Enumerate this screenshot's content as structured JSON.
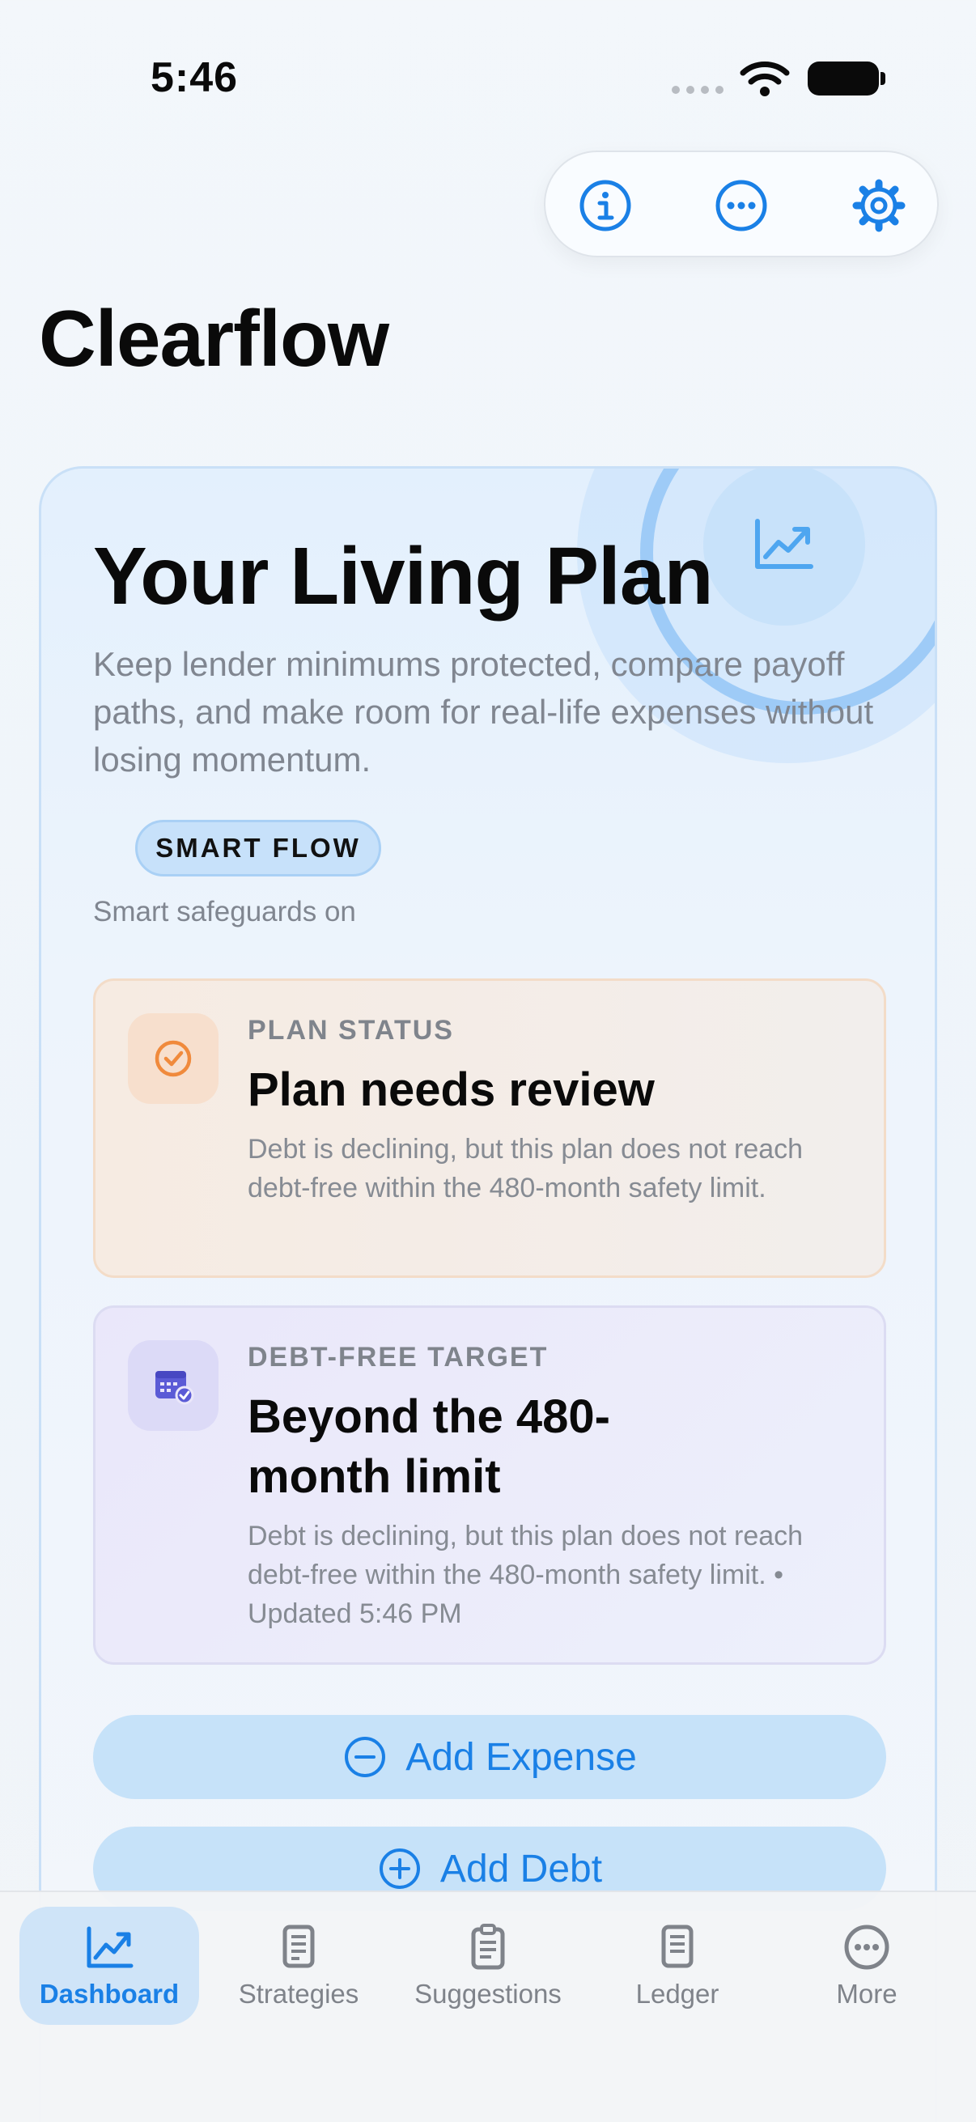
{
  "status_bar": {
    "time": "5:46"
  },
  "app": {
    "title": "Clearflow"
  },
  "hero": {
    "title": "Your Living Plan",
    "subtitle": "Keep lender minimums protected, compare payoff paths, and make room for real-life expenses without losing momentum.",
    "chip": "SMART FLOW",
    "safeguards": "Smart safeguards on"
  },
  "cards": {
    "status": {
      "label": "PLAN STATUS",
      "title": "Plan needs review",
      "description": "Debt is declining, but this plan does not reach debt-free within the 480-month safety limit."
    },
    "target": {
      "label": "DEBT-FREE TARGET",
      "title": "Beyond the 480-month limit",
      "description": "Debt is declining, but this plan does not reach debt-free within the 480-month safety limit. • Updated 5:46 PM"
    }
  },
  "actions": {
    "add_expense": "Add Expense",
    "add_debt": "Add Debt"
  },
  "tabs": [
    {
      "label": "Dashboard",
      "icon": "chart-icon",
      "active": true
    },
    {
      "label": "Strategies",
      "icon": "document-icon"
    },
    {
      "label": "Suggestions",
      "icon": "clipboard-icon"
    },
    {
      "label": "Ledger",
      "icon": "ledger-icon"
    },
    {
      "label": "More",
      "icon": "ellipsis-circle-icon"
    }
  ],
  "colors": {
    "accent": "#1a80e6",
    "status_icon": "#f08a3c",
    "target_icon": "#5b5bd6"
  }
}
